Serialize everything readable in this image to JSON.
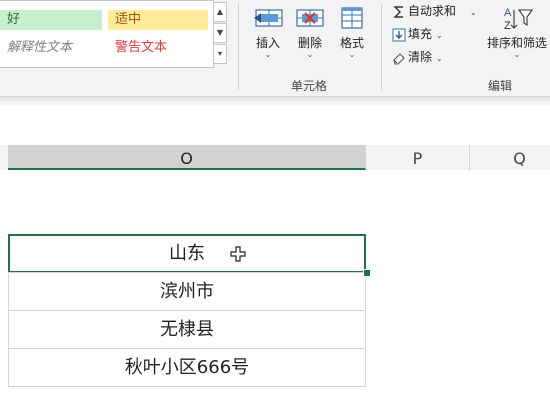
{
  "cell_styles": {
    "good": "好",
    "neutral": "适中",
    "explanatory": "解释性文本",
    "warning": "警告文本"
  },
  "cells_group": {
    "insert": "插入",
    "delete": "删除",
    "format": "格式",
    "group_label": "单元格"
  },
  "editing_group": {
    "autosum": "自动求和",
    "fill": "填充",
    "clear": "清除",
    "sort_filter": "排序和筛选",
    "group_label": "编辑"
  },
  "columns": [
    "O",
    "P",
    "Q"
  ],
  "cells": [
    "山东",
    "滨州市",
    "无棣县",
    "秋叶小区666号"
  ],
  "colors": {
    "accent": "#217346",
    "good_bg": "#c6efce",
    "neutral_bg": "#ffeb9c",
    "warning": "#e03a3a"
  }
}
